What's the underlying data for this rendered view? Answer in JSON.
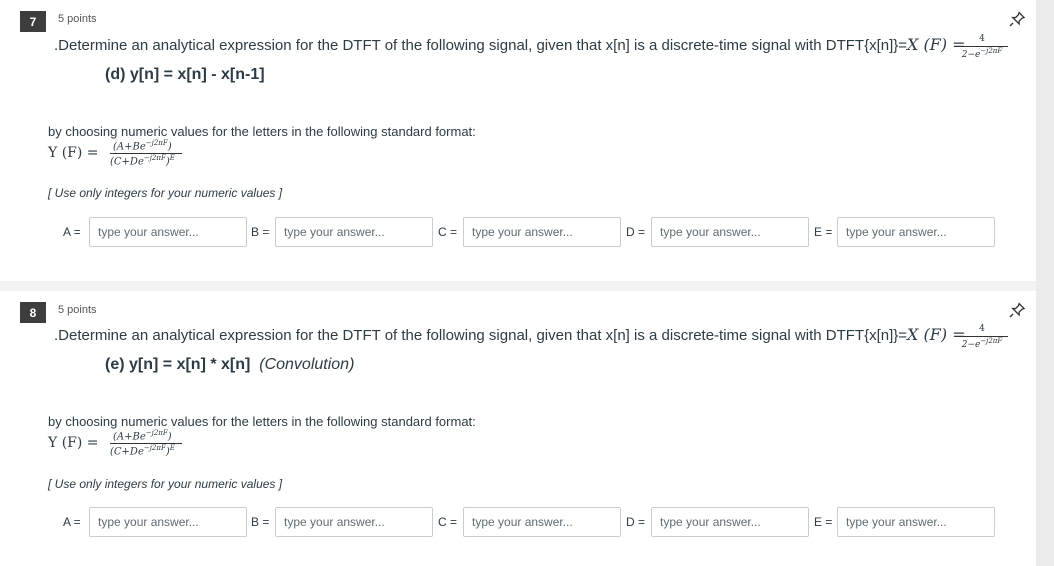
{
  "questions": [
    {
      "number": "7",
      "points": "5 points",
      "prompt_text": ".Determine an analytical expression for the DTFT of the following signal, given that x[n] is a discrete-time signal with DTFT{x[n]}=",
      "prompt_math": "X (F) =",
      "dtft_numerator": "4",
      "dtft_denominator": "2−e",
      "dtft_exponent": "−j2πF",
      "subquestion": "(d) y[n] = x[n] - x[n-1]",
      "subquestion_note": "",
      "choose_text": "by choosing numeric values for the letters in the following standard format:",
      "formula_lhs": "Y (F) =",
      "formula_numerator": "(A+Be",
      "formula_numerator_exp": "−j2πF",
      "formula_denominator": "(C+De",
      "formula_denominator_exp": "−j2πF",
      "formula_power": "E",
      "note": "[ Use only integers for your numeric values ]",
      "answers": [
        {
          "label": "A =",
          "placeholder": "type your answer..."
        },
        {
          "label": "B =",
          "placeholder": "type your answer..."
        },
        {
          "label": "C =",
          "placeholder": "type your answer..."
        },
        {
          "label": "D =",
          "placeholder": "type your answer..."
        },
        {
          "label": "E =",
          "placeholder": "type your answer..."
        }
      ]
    },
    {
      "number": "8",
      "points": "5 points",
      "prompt_text": ".Determine an analytical expression for the DTFT of the following signal, given that x[n] is a discrete-time signal with DTFT{x[n]}=",
      "prompt_math": "X (F) =",
      "dtft_numerator": "4",
      "dtft_denominator": "2−e",
      "dtft_exponent": "−j2πF",
      "subquestion": "(e) y[n] = x[n] * x[n]",
      "subquestion_note": "(Convolution)",
      "choose_text": "by choosing numeric values for the letters in the following standard format:",
      "formula_lhs": "Y (F) =",
      "formula_numerator": "(A+Be",
      "formula_numerator_exp": "−j2πF",
      "formula_denominator": "(C+De",
      "formula_denominator_exp": "−j2πF",
      "formula_power": "E",
      "note": "[ Use only integers for your numeric values ]",
      "answers": [
        {
          "label": "A =",
          "placeholder": "type your answer..."
        },
        {
          "label": "B =",
          "placeholder": "type your answer..."
        },
        {
          "label": "C =",
          "placeholder": "type your answer..."
        },
        {
          "label": "D =",
          "placeholder": "type your answer..."
        },
        {
          "label": "E =",
          "placeholder": "type your answer..."
        }
      ]
    }
  ],
  "icons": {
    "pin": "pin-icon"
  }
}
